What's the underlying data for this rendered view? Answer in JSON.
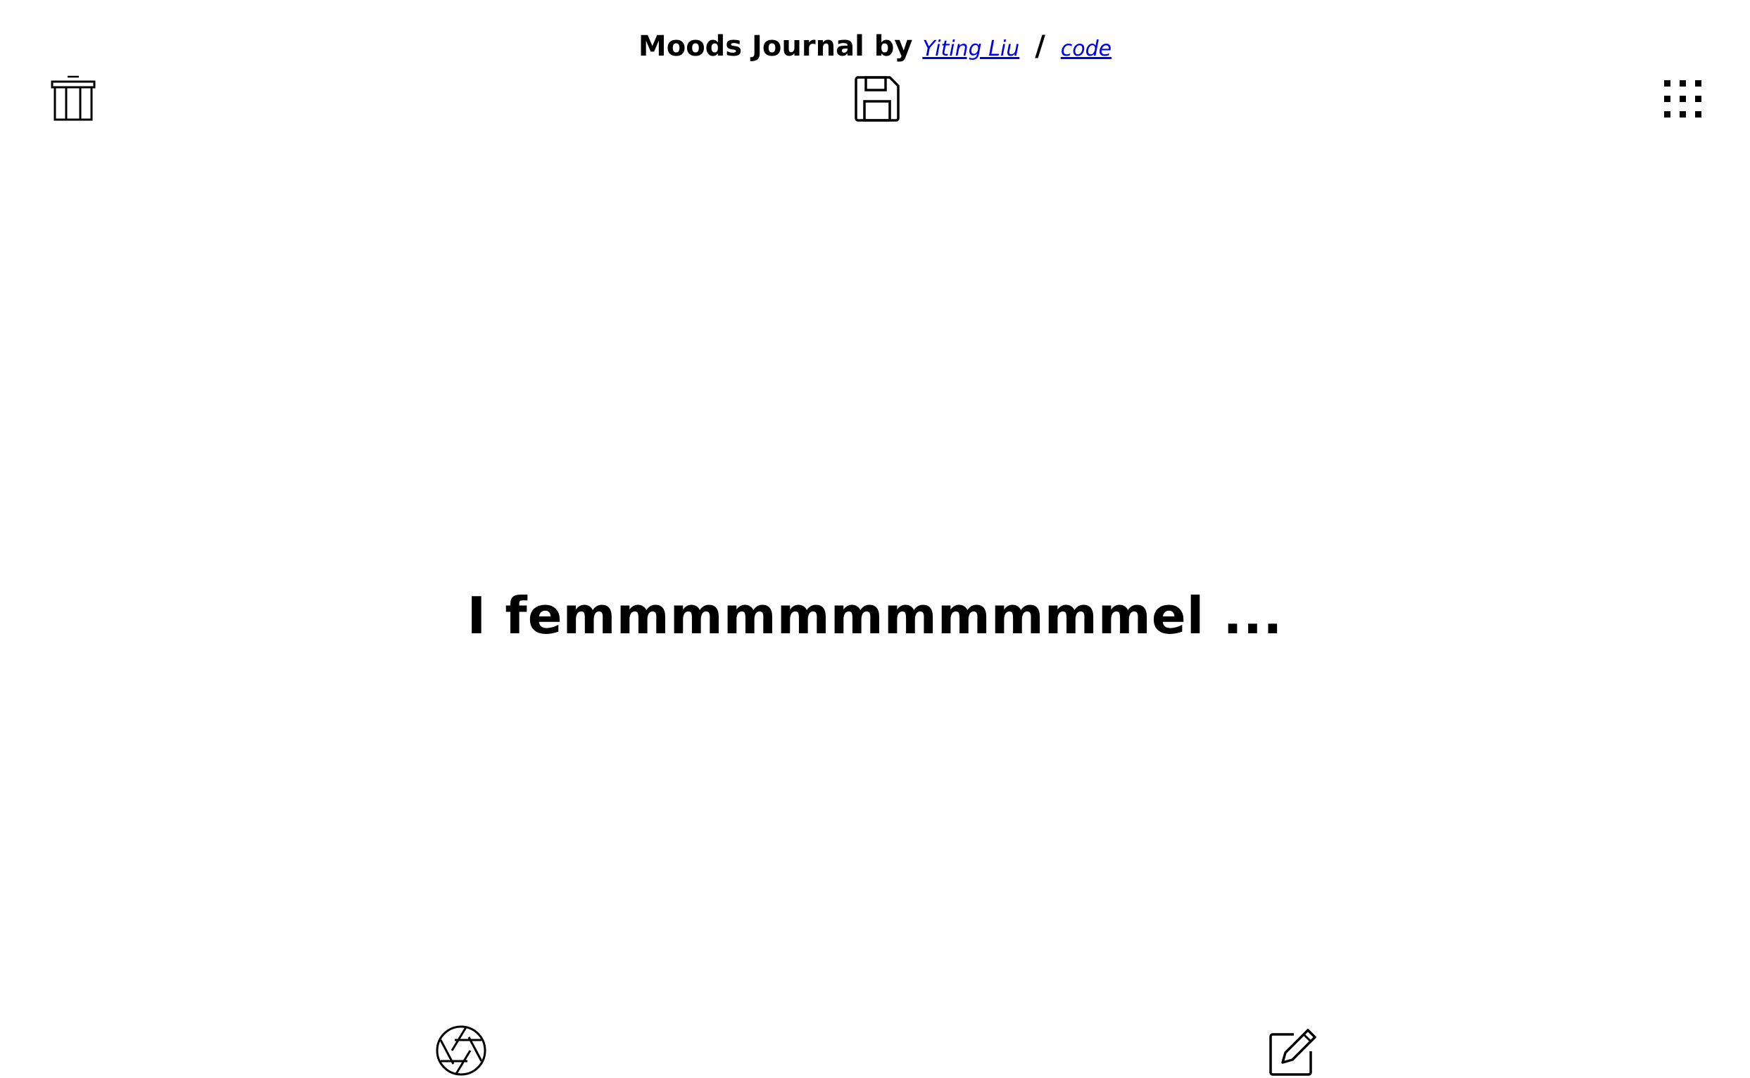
{
  "header": {
    "title": "Moods Journal by",
    "author_link": "Yiting Liu",
    "separator": "/",
    "code_link": "code"
  },
  "toolbar": {
    "trash_icon": "trash-icon",
    "save_icon": "save-icon",
    "grid_icon": "grid-icon"
  },
  "main": {
    "mood_text": "I femmmmmmmmmmmel ..."
  },
  "bottom_bar": {
    "camera_icon": "aperture-icon",
    "edit_icon": "edit-icon"
  },
  "colors": {
    "link": "#0000ee",
    "text": "#000000",
    "background": "#ffffff"
  }
}
